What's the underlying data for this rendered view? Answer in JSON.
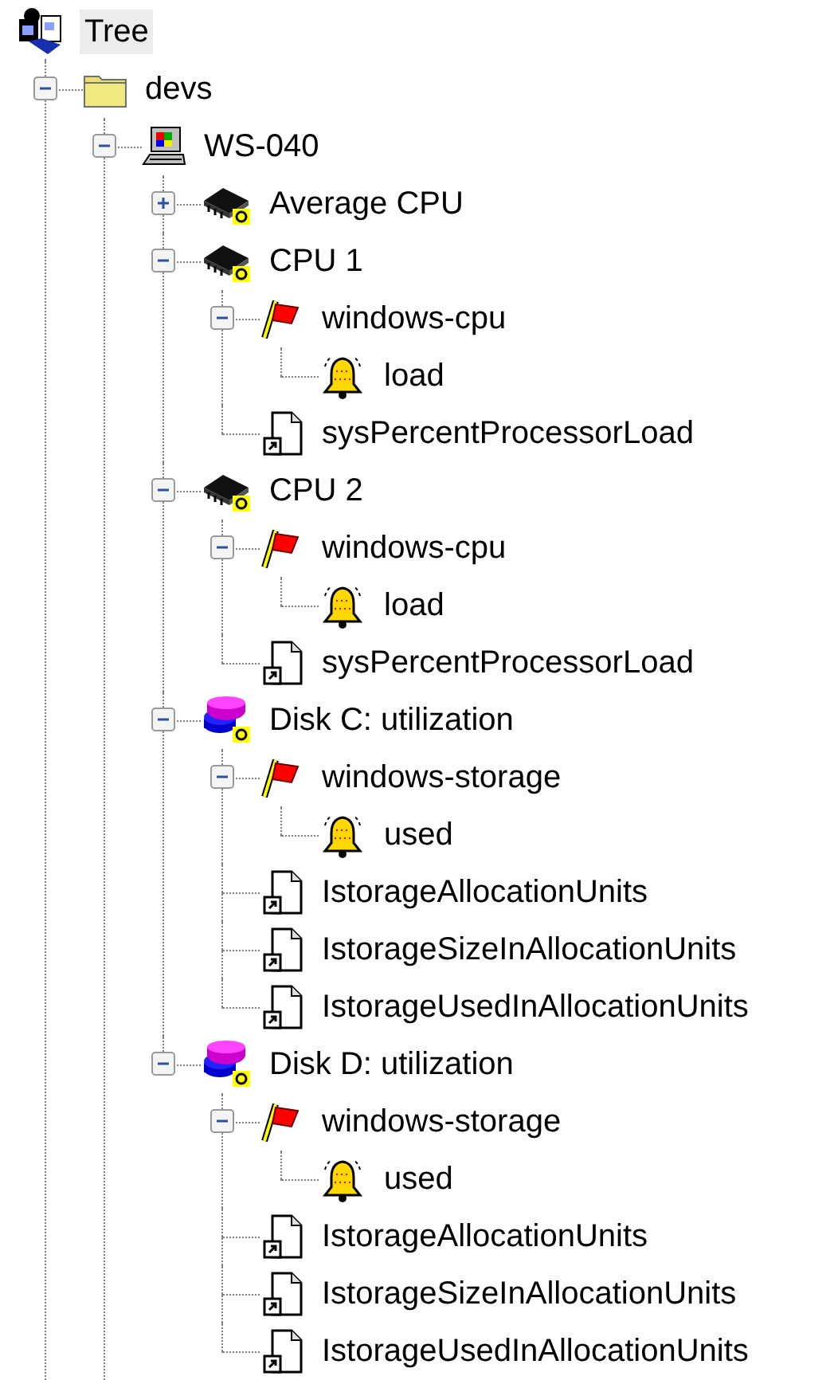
{
  "tree": {
    "label": "Tree",
    "kind": "network",
    "selected": true,
    "children": [
      {
        "label": "devs",
        "kind": "folder",
        "selected": false,
        "expanded": true,
        "children": [
          {
            "label": "WS-040",
            "kind": "computer",
            "selected": false,
            "expanded": true,
            "children": [
              {
                "label": "Average CPU",
                "kind": "chip",
                "selected": false,
                "expanded": false
              },
              {
                "label": "CPU 1",
                "kind": "chip",
                "selected": false,
                "expanded": true,
                "children": [
                  {
                    "label": "windows-cpu",
                    "kind": "flag",
                    "selected": false,
                    "expanded": true,
                    "children": [
                      {
                        "label": "load",
                        "kind": "bell",
                        "selected": false
                      }
                    ]
                  },
                  {
                    "label": "sysPercentProcessorLoad",
                    "kind": "document",
                    "selected": false
                  }
                ]
              },
              {
                "label": "CPU 2",
                "kind": "chip",
                "selected": false,
                "expanded": true,
                "children": [
                  {
                    "label": "windows-cpu",
                    "kind": "flag",
                    "selected": false,
                    "expanded": true,
                    "children": [
                      {
                        "label": "load",
                        "kind": "bell",
                        "selected": false
                      }
                    ]
                  },
                  {
                    "label": "sysPercentProcessorLoad",
                    "kind": "document",
                    "selected": false
                  }
                ]
              },
              {
                "label": "Disk C: utilization",
                "kind": "disk",
                "selected": false,
                "expanded": true,
                "children": [
                  {
                    "label": "windows-storage",
                    "kind": "flag",
                    "selected": false,
                    "expanded": true,
                    "children": [
                      {
                        "label": "used",
                        "kind": "bell",
                        "selected": false
                      }
                    ]
                  },
                  {
                    "label": "IstorageAllocationUnits",
                    "kind": "document",
                    "selected": false
                  },
                  {
                    "label": "IstorageSizeInAllocationUnits",
                    "kind": "document",
                    "selected": false
                  },
                  {
                    "label": "IstorageUsedInAllocationUnits",
                    "kind": "document",
                    "selected": false
                  }
                ]
              },
              {
                "label": "Disk D: utilization",
                "kind": "disk",
                "selected": false,
                "expanded": true,
                "children": [
                  {
                    "label": "windows-storage",
                    "kind": "flag",
                    "selected": false,
                    "expanded": true,
                    "children": [
                      {
                        "label": "used",
                        "kind": "bell",
                        "selected": false
                      }
                    ]
                  },
                  {
                    "label": "IstorageAllocationUnits",
                    "kind": "document",
                    "selected": false
                  },
                  {
                    "label": "IstorageSizeInAllocationUnits",
                    "kind": "document",
                    "selected": false
                  },
                  {
                    "label": "IstorageUsedInAllocationUnits",
                    "kind": "document",
                    "selected": false
                  }
                ]
              }
            ]
          }
        ]
      }
    ]
  }
}
